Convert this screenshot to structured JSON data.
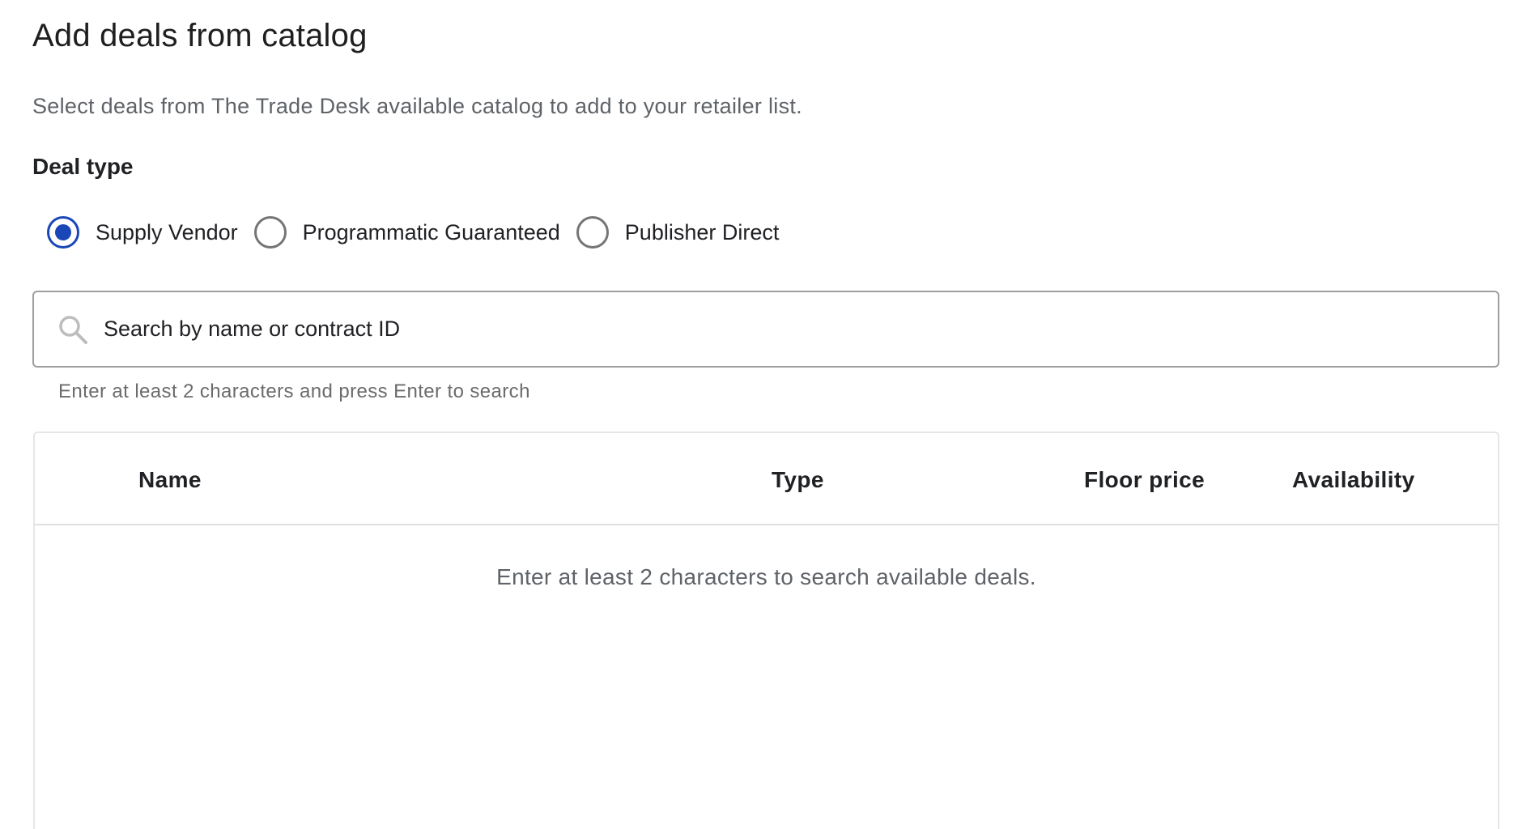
{
  "page": {
    "title": "Add deals from catalog",
    "subtitle": "Select deals from The Trade Desk available catalog to add to your retailer list."
  },
  "deal_type": {
    "label": "Deal type",
    "options": [
      {
        "label": "Supply Vendor",
        "checked": true
      },
      {
        "label": "Programmatic Guaranteed",
        "checked": false
      },
      {
        "label": "Publisher Direct",
        "checked": false
      }
    ]
  },
  "search": {
    "placeholder": "Search by name or contract ID",
    "value": "",
    "helper": "Enter at least 2 characters and press Enter to search",
    "icon": "search-icon"
  },
  "table": {
    "columns": [
      "Name",
      "Type",
      "Floor price",
      "Availability"
    ],
    "rows": [],
    "empty_message": "Enter at least 2 characters to search available deals."
  },
  "colors": {
    "accent": "#1a47b8",
    "border": "#9e9e9e",
    "muted_text": "#5f6368"
  }
}
